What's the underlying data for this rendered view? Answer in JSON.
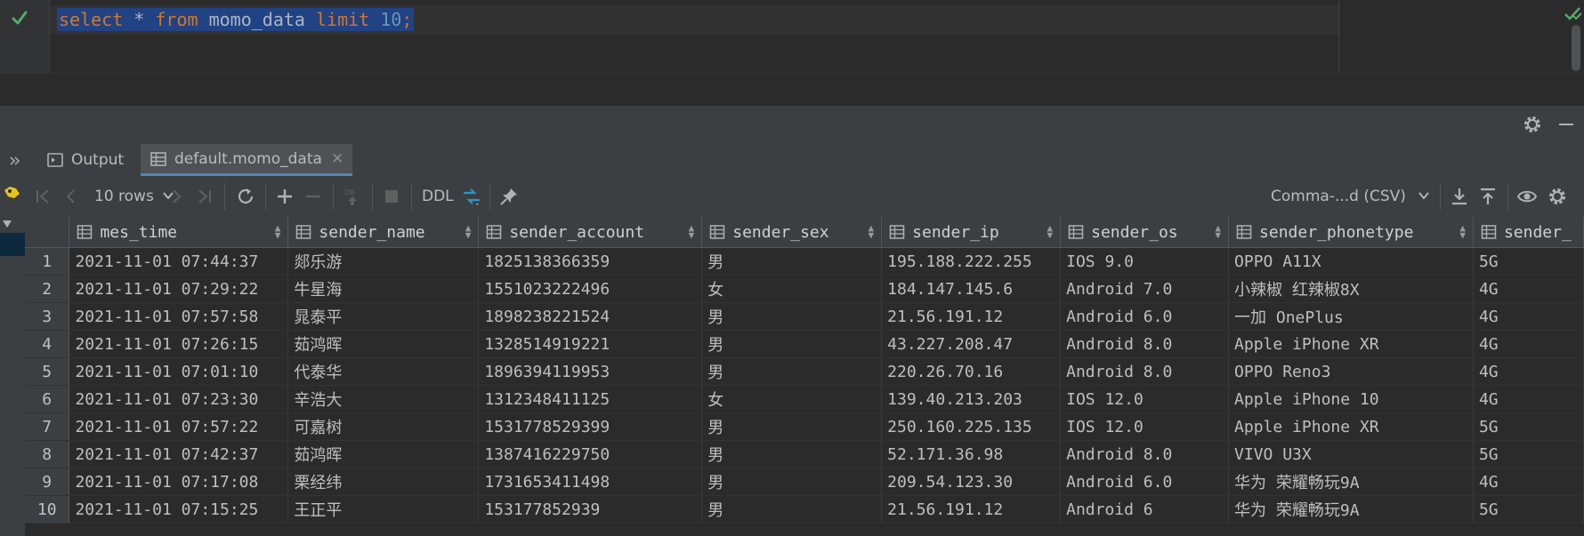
{
  "editor": {
    "sql": [
      {
        "t": "select",
        "c": "kw"
      },
      {
        "t": " * ",
        "c": "ident"
      },
      {
        "t": "from",
        "c": "kw"
      },
      {
        "t": " momo_data ",
        "c": "ident"
      },
      {
        "t": "limit",
        "c": "kw"
      },
      {
        "t": " ",
        "c": "ident"
      },
      {
        "t": "10",
        "c": "num"
      },
      {
        "t": ";",
        "c": "semi"
      }
    ]
  },
  "tabs": {
    "output_label": "Output",
    "data_label": "default.momo_data",
    "close_glyph": "✕"
  },
  "toolbar": {
    "page_size": "10 rows",
    "ddl_label": "DDL",
    "export_format": "Comma-...d (CSV)"
  },
  "colors": {
    "accent": "#4a88c7",
    "keyword": "#cc7832",
    "number": "#6897bb",
    "selection": "#214283",
    "ok_green": "#4caf50"
  },
  "grid": {
    "columns": [
      "mes_time",
      "sender_name",
      "sender_account",
      "sender_sex",
      "sender_ip",
      "sender_os",
      "sender_phonetype",
      "sender_"
    ],
    "rows": [
      [
        "1",
        "2021-11-01 07:44:37",
        "郯乐游",
        "1825138366359",
        "男",
        "195.188.222.255",
        "IOS 9.0",
        "OPPO A11X",
        "5G"
      ],
      [
        "2",
        "2021-11-01 07:29:22",
        "牛星海",
        "1551023222496",
        "女",
        "184.147.145.6",
        "Android 7.0",
        "小辣椒 红辣椒8X",
        "4G"
      ],
      [
        "3",
        "2021-11-01 07:57:58",
        "晁泰平",
        "1898238221524",
        "男",
        "21.56.191.12",
        "Android 6.0",
        "一加 OnePlus",
        "4G"
      ],
      [
        "4",
        "2021-11-01 07:26:15",
        "茹鸿晖",
        "1328514919221",
        "男",
        "43.227.208.47",
        "Android 8.0",
        "Apple iPhone XR",
        "4G"
      ],
      [
        "5",
        "2021-11-01 07:01:10",
        "代泰华",
        "1896394119953",
        "男",
        "220.26.70.16",
        "Android 8.0",
        "OPPO Reno3",
        "4G"
      ],
      [
        "6",
        "2021-11-01 07:23:30",
        "辛浩大",
        "1312348411125",
        "女",
        "139.40.213.203",
        "IOS 12.0",
        "Apple iPhone 10",
        "4G"
      ],
      [
        "7",
        "2021-11-01 07:57:22",
        "可嘉树",
        "1531778529399",
        "男",
        "250.160.225.135",
        "IOS 12.0",
        "Apple iPhone XR",
        "5G"
      ],
      [
        "8",
        "2021-11-01 07:42:37",
        "茹鸿晖",
        "1387416229750",
        "男",
        "52.171.36.98",
        "Android 8.0",
        "VIVO U3X",
        "5G"
      ],
      [
        "9",
        "2021-11-01 07:17:08",
        "栗经纬",
        "1731653411498",
        "男",
        "209.54.123.30",
        "Android 6.0",
        "华为 荣耀畅玩9A",
        "4G"
      ],
      [
        "10",
        "2021-11-01 07:15:25",
        "王正平",
        "153177852939",
        "男",
        "21.56.191.12",
        "Android 6",
        "华为 荣耀畅玩9A",
        "5G"
      ]
    ]
  }
}
